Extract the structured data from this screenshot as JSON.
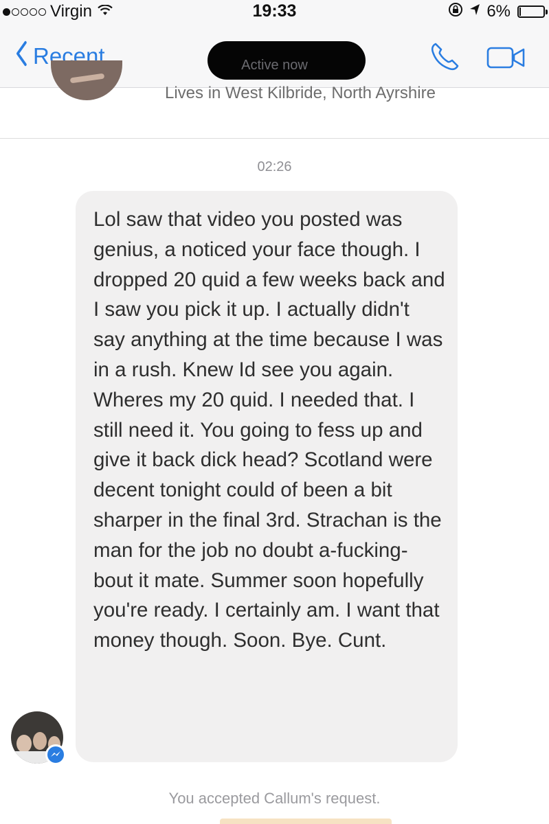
{
  "status_bar": {
    "signal_filled": 1,
    "signal_total": 5,
    "carrier": "Virgin",
    "time": "19:33",
    "battery": "6%",
    "battery_level": 0.06
  },
  "nav": {
    "back_label": "Recent",
    "subtitle": "Active now"
  },
  "profile": {
    "lives_in": "Lives in West Kilbride, North Ayrshire"
  },
  "conversation": {
    "timestamp": "02:26",
    "message": "Lol saw that video you posted was genius, a noticed your face though. I dropped 20 quid a few weeks back and I saw you pick it up. I actually didn't say anything at the time because I was in a rush. Knew Id see you again. Wheres my 20 quid. I needed that. I still need it. You going to fess up and give it back dick head? Scotland were decent tonight could of been a bit sharper in the final 3rd. Strachan is the man for the job no doubt a-fucking-bout it mate. Summer soon hopefully you're ready. I certainly am. I want that money though. Soon. Bye. Cunt.",
    "system_notice": "You accepted Callum's request."
  },
  "colors": {
    "accent": "#2a7de1",
    "bubble": "#f1f0f0",
    "redaction": "#050505"
  },
  "icons": {
    "back": "chevron-left-icon",
    "call": "phone-icon",
    "video": "video-camera-icon",
    "wifi": "wifi-icon",
    "badge": "messenger-icon"
  }
}
